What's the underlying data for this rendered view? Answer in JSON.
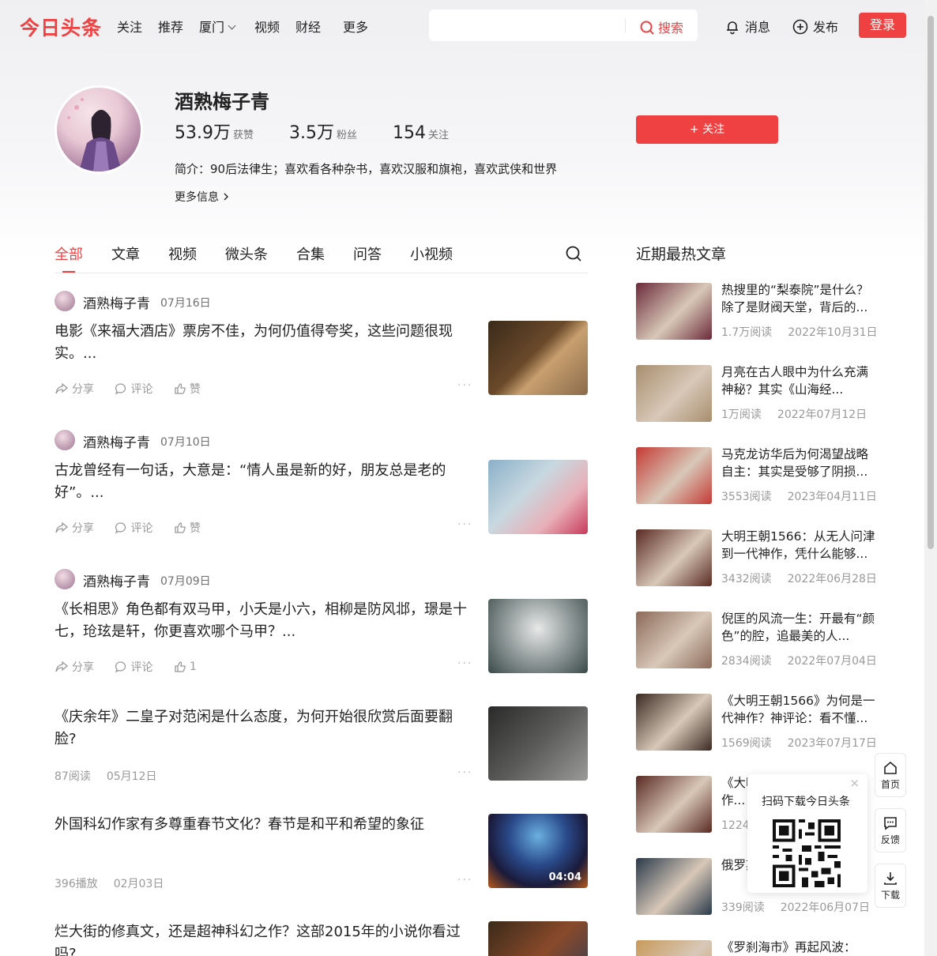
{
  "header": {
    "logo": "今日头条",
    "nav": [
      "关注",
      "推荐",
      "厦门",
      "视频",
      "财经",
      "更多"
    ],
    "search_placeholder": "",
    "search_button": "搜索",
    "messages": "消息",
    "publish": "发布",
    "login": "登录"
  },
  "profile": {
    "name": "酒熟梅子青",
    "likes_value": "53.9万",
    "likes_label": "获赞",
    "fans_value": "3.5万",
    "fans_label": "粉丝",
    "following_value": "154",
    "following_label": "关注",
    "bio": "简介：90后法律生；喜欢看各种杂书，喜欢汉服和旗袍，喜欢武侠和世界",
    "more_info": "更多信息",
    "follow_button": "+ 关注"
  },
  "tabs": [
    "全部",
    "文章",
    "视频",
    "微头条",
    "合集",
    "问答",
    "小视频"
  ],
  "feed": [
    {
      "author": "酒熟梅子青",
      "date": "07月16日",
      "title": "电影《来福大酒店》票房不佳，为何仍值得夸奖，这些问题很现实。...",
      "share": "分享",
      "comment": "评论",
      "like": "赞"
    },
    {
      "author": "酒熟梅子青",
      "date": "07月10日",
      "title": "古龙曾经有一句话，大意是：“情人虽是新的好，朋友总是老的好”。...",
      "share": "分享",
      "comment": "评论",
      "like": "赞"
    },
    {
      "author": "酒熟梅子青",
      "date": "07月09日",
      "title": "《长相思》角色都有双马甲，小夭是小六，相柳是防风邶，璟是十七，玱玹是轩，你更喜欢哪个马甲？...",
      "share": "分享",
      "comment": "评论",
      "like": "1"
    },
    {
      "title": "《庆余年》二皇子对范闲是什么态度，为何开始很欣赏后面要翻脸?",
      "reads": "87阅读",
      "date": "05月12日"
    },
    {
      "title": "外国科幻作家有多尊重春节文化？春节是和平和希望的象征",
      "reads": "396播放",
      "date": "02月03日",
      "duration": "04:04"
    },
    {
      "title": "烂大街的修真文，还是超神科幻之作？这部2015年的小说你看过吗?"
    }
  ],
  "sidebar": {
    "title": "近期最热文章",
    "items": [
      {
        "title": "热搜里的“梨泰院”是什么？除了是财阀天堂，背后的...",
        "reads": "1.7万阅读",
        "date": "2022年10月31日",
        "color": "#6b2a3a"
      },
      {
        "title": "月亮在古人眼中为什么充满神秘？其实《山海经...",
        "reads": "1万阅读",
        "date": "2022年07月12日",
        "color": "#a88e6e"
      },
      {
        "title": "马克龙访华后为何渴望战略自主：其实是受够了阴损...",
        "reads": "3553阅读",
        "date": "2023年04月11日",
        "color": "#c43a34"
      },
      {
        "title": "大明王朝1566：从无人问津到一代神作，凭什么能够...",
        "reads": "3432阅读",
        "date": "2022年06月28日",
        "color": "#5a2a22"
      },
      {
        "title": "倪匡的风流一生：开最有“颜色”的腔，追最美的人...",
        "reads": "2834阅读",
        "date": "2022年07月04日",
        "color": "#8c6a5a"
      },
      {
        "title": "《大明王朝1566》为何是一代神作？神评论：看不懂...",
        "reads": "1569阅读",
        "date": "2023年07月17日",
        "color": "#3a2a22"
      },
      {
        "title": "《大明王朝1566》...代神作...",
        "reads": "1224阅读",
        "date": "",
        "color": "#5a2a22"
      },
      {
        "title": "俄罗斯...类的...",
        "reads": "339阅读",
        "date": "2022年06月07日",
        "color": "#2a3a4a"
      },
      {
        "title": "《罗刹海市》再起风波：",
        "reads": "",
        "date": "",
        "color": "#c89a5a"
      }
    ]
  },
  "qr_popup": {
    "label": "扫码下载今日头条",
    "close": "×"
  },
  "fabs": {
    "home": "首页",
    "feedback": "反馈",
    "download": "下载"
  },
  "colors": {
    "brand": "#f04142",
    "muted": "#999999"
  }
}
